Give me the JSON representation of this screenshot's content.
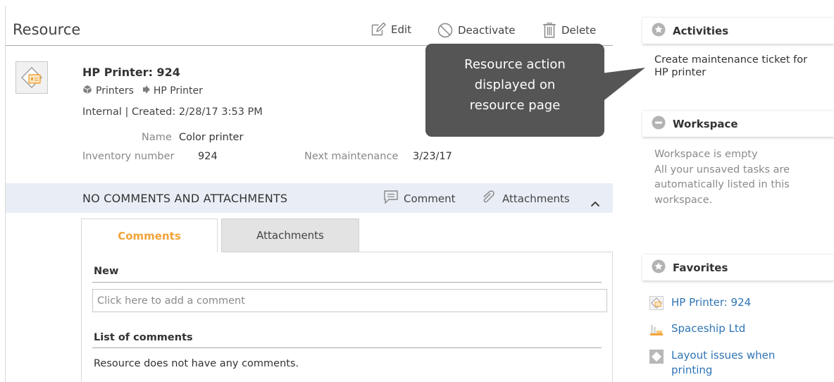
{
  "resource": {
    "title": "Resource",
    "toolbar": {
      "edit_label": "Edit",
      "deactivate_label": "Deactivate",
      "delete_label": "Delete"
    },
    "name": "HP Printer: 924",
    "breadcrumb": [
      "Printers",
      "HP Printer"
    ],
    "created_line": "Internal | Created: 2/28/17 3:53 PM",
    "properties": {
      "name_label": "Name",
      "name_value": "Color printer",
      "inventory_label": "Inventory number",
      "inventory_value": "924",
      "maintenance_label": "Next maintenance",
      "maintenance_value": "3/23/17"
    }
  },
  "comments_section": {
    "title": "NO COMMENTS AND ATTACHMENTS",
    "comment_button": "Comment",
    "attachments_button": "Attachments",
    "tabs": [
      {
        "label": "Comments",
        "active": true
      },
      {
        "label": "Attachments",
        "active": false
      }
    ],
    "new_label": "New",
    "input_placeholder": "Click here to add a comment",
    "list_label": "List of comments",
    "empty_text": "Resource does not have any comments."
  },
  "callout": {
    "lines": [
      "Resource action",
      "displayed on",
      "resource page"
    ]
  },
  "sidebar": {
    "activities": {
      "title": "Activities",
      "item_line1": "Create maintenance ticket for",
      "item_line2": "HP printer"
    },
    "workspace": {
      "title": "Workspace",
      "empty_text": "Workspace is empty",
      "help_lines": [
        "All your unsaved tasks are",
        "automatically listed in this",
        "workspace."
      ]
    },
    "favorites": {
      "title": "Favorites",
      "items": [
        {
          "label": "HP Printer: 924",
          "icon": "printer-resource-icon"
        },
        {
          "label": "Spaceship Ltd",
          "icon": "company-icon"
        },
        {
          "label_line1": "Layout issues when",
          "label_line2": "printing",
          "icon": "ticket-icon"
        }
      ]
    }
  },
  "colors": {
    "accent_orange": "#f2a33a",
    "link_blue": "#2e74b5",
    "callout_bg": "#555555",
    "comments_bar_bg": "#e9eef6"
  }
}
